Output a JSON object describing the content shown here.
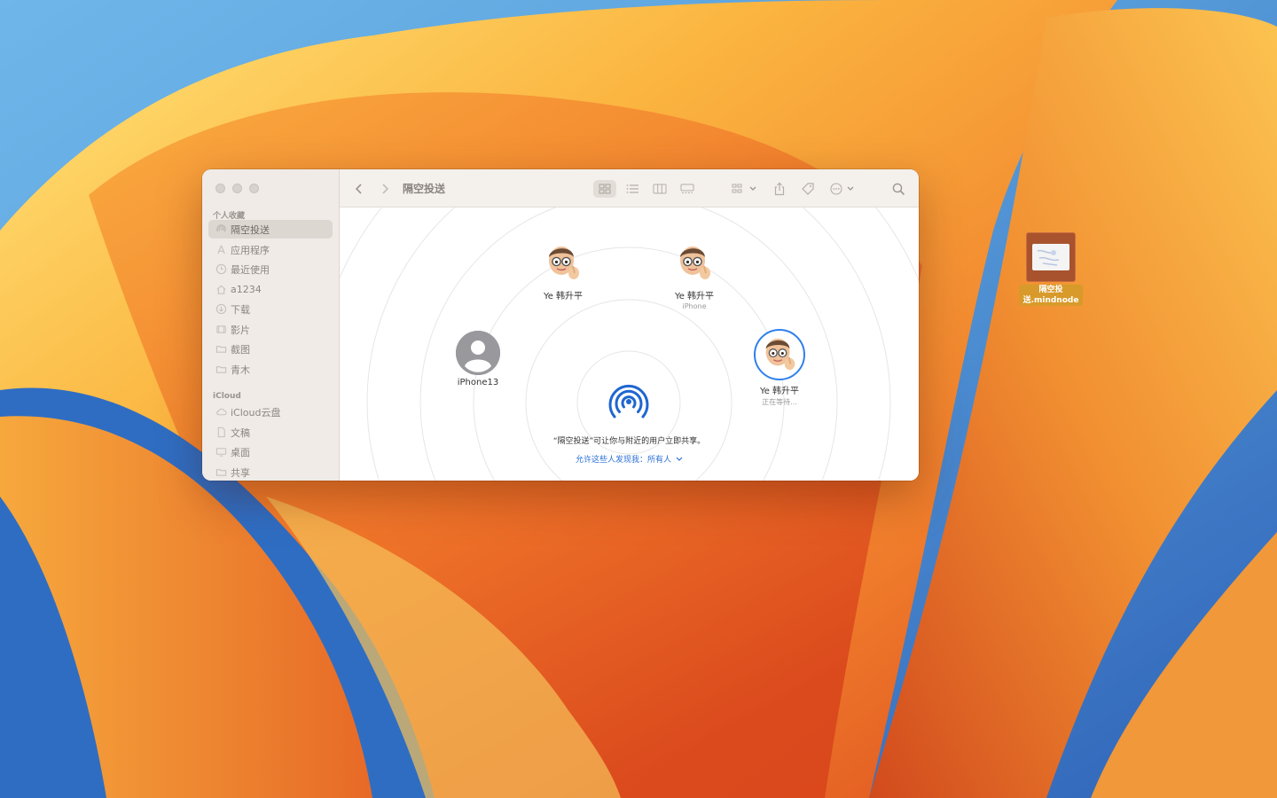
{
  "desktop": {
    "file": {
      "name_line1": "隔空投",
      "name_line2": "送.mindnode",
      "icon": "mindnode-file-icon"
    }
  },
  "window": {
    "title": "隔空投送",
    "toolbar": {
      "back_icon": "chevron-left-icon",
      "forward_icon": "chevron-right-icon",
      "view_icons": [
        "grid-view-icon",
        "list-view-icon",
        "column-view-icon",
        "gallery-view-icon"
      ],
      "group_icon": "group-by-icon",
      "share_icon": "share-icon",
      "tag_icon": "tag-icon",
      "more_icon": "ellipsis-circle-icon",
      "search_icon": "search-icon"
    },
    "sidebar": {
      "favorites_header": "个人收藏",
      "favorites": [
        {
          "label": "隔空投送",
          "icon": "airdrop-icon",
          "active": true
        },
        {
          "label": "应用程序",
          "icon": "applications-icon"
        },
        {
          "label": "最近使用",
          "icon": "clock-icon"
        },
        {
          "label": "a1234",
          "icon": "home-icon"
        },
        {
          "label": "下载",
          "icon": "download-icon"
        },
        {
          "label": "影片",
          "icon": "film-icon"
        },
        {
          "label": "截图",
          "icon": "folder-icon"
        },
        {
          "label": "青木",
          "icon": "folder-icon"
        }
      ],
      "icloud_header": "iCloud",
      "icloud": [
        {
          "label": "iCloud云盘",
          "icon": "cloud-icon"
        },
        {
          "label": "文稿",
          "icon": "document-icon"
        },
        {
          "label": "桌面",
          "icon": "desktop-icon"
        },
        {
          "label": "共享",
          "icon": "shared-folder-icon"
        }
      ]
    },
    "airdrop": {
      "people": [
        {
          "name": "Ye 韩升平",
          "sub": ""
        },
        {
          "name": "Ye 韩升平",
          "sub": "iPhone"
        },
        {
          "name": "iPhone13",
          "sub": ""
        },
        {
          "name": "Ye 韩升平",
          "sub": "正在等待..."
        }
      ],
      "description": "“隔空投送”可让你与附近的用户立即共享。",
      "discover_label": "允许这些人发现我：所有人"
    }
  }
}
